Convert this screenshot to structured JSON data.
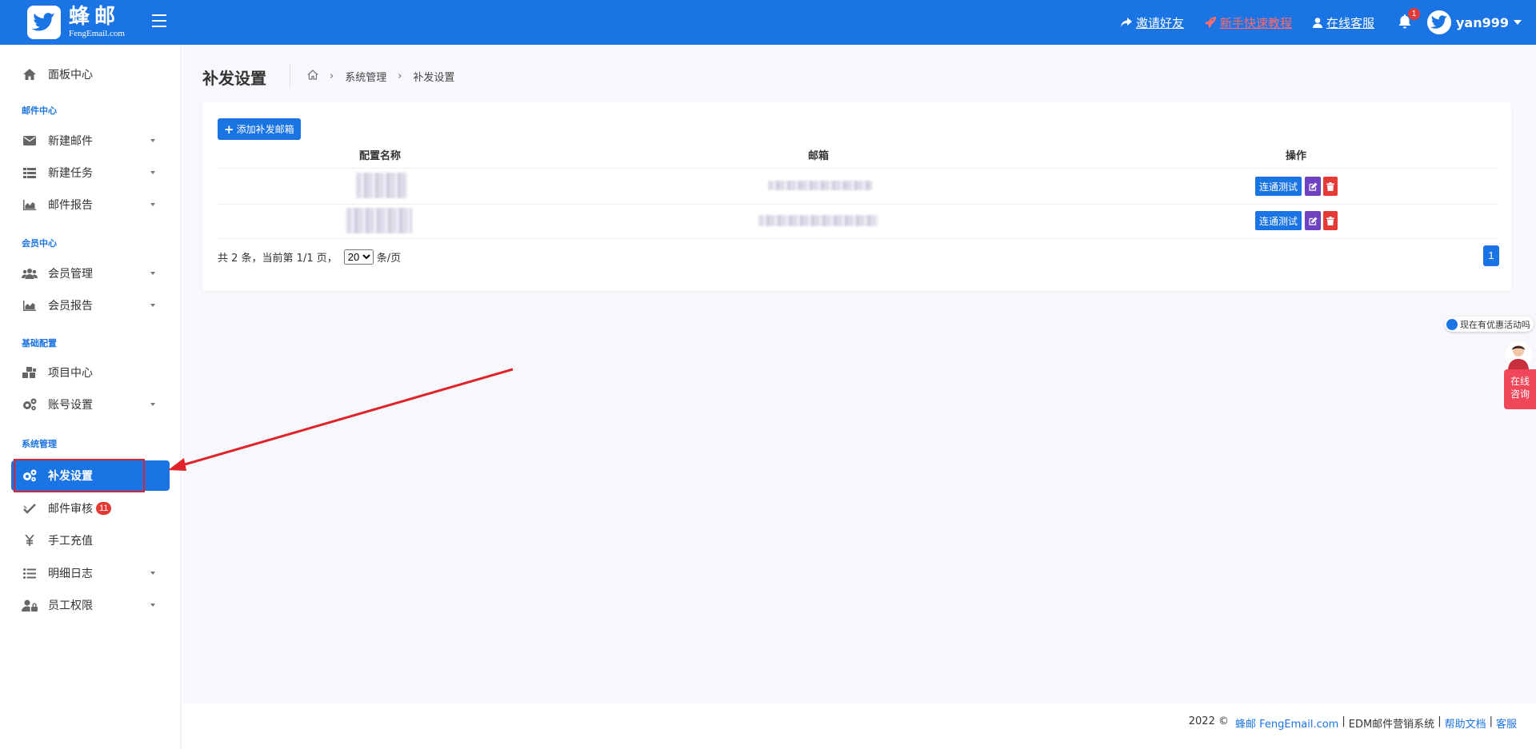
{
  "header": {
    "logo_cn": "蜂邮",
    "logo_en": "FengEmail.com",
    "links": [
      {
        "label": "邀请好友",
        "icon": "share-icon"
      },
      {
        "label": "新手快速教程",
        "icon": "rocket-icon",
        "color": "#ff6b6b"
      },
      {
        "label": "在线客服",
        "icon": "user-icon"
      }
    ],
    "notification_count": "1",
    "username": "yan999"
  },
  "sidebar": {
    "items": [
      {
        "label": "面板中心",
        "icon": "home-icon"
      },
      {
        "label": "新建邮件",
        "icon": "envelope-icon"
      },
      {
        "label": "新建任务",
        "icon": "list-icon"
      },
      {
        "label": "邮件报告",
        "icon": "area-chart-icon"
      },
      {
        "label": "会员管理",
        "icon": "users-icon"
      },
      {
        "label": "会员报告",
        "icon": "area-chart-icon"
      },
      {
        "label": "项目中心",
        "icon": "cubes-icon"
      },
      {
        "label": "账号设置",
        "icon": "cogs-icon"
      },
      {
        "label": "补发设置",
        "icon": "cogs-icon"
      },
      {
        "label": "邮件审核",
        "icon": "check-icon",
        "badge": "11"
      },
      {
        "label": "手工充值",
        "icon": "yen-icon"
      },
      {
        "label": "明细日志",
        "icon": "list-ul-icon"
      },
      {
        "label": "员工权限",
        "icon": "user-lock-icon"
      }
    ],
    "sections": [
      "邮件中心",
      "会员中心",
      "基础配置",
      "系统管理"
    ],
    "active_item": "补发设置"
  },
  "page": {
    "title": "补发设置",
    "breadcrumb": [
      "系统管理",
      "补发设置"
    ]
  },
  "table": {
    "add_button": "添加补发邮箱",
    "columns": [
      "配置名称",
      "邮箱",
      "操作"
    ],
    "row_actions": {
      "test": "连通测试"
    },
    "row_count": 2
  },
  "pagination": {
    "prefix": "共 2 条，当前第 1/1 页，",
    "page_size": "20",
    "suffix": "条/页",
    "current_page": "1"
  },
  "chat": {
    "promo": "现在有优惠活动吗",
    "tab_label_1": "在线",
    "tab_label_2": "咨询"
  },
  "footer": {
    "year": "2022 ©",
    "brand": "蜂邮 FengEmail.com",
    "product": "EDM邮件营销系统",
    "help": "帮助文档",
    "service": "客服"
  },
  "colors": {
    "primary": "#1b74e4",
    "danger": "#e53935",
    "edit": "#6f42c1",
    "annotation": "#e0232a"
  }
}
